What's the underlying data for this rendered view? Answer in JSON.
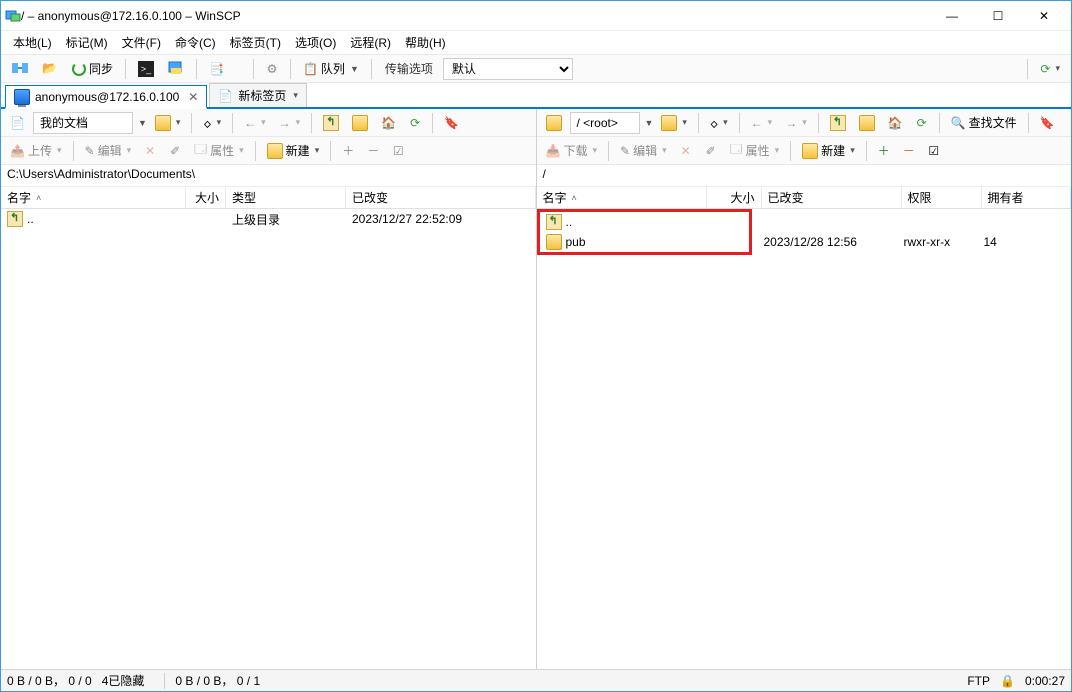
{
  "window": {
    "title": "/ – anonymous@172.16.0.100 – WinSCP"
  },
  "menu": {
    "items": [
      "本地(L)",
      "标记(M)",
      "文件(F)",
      "命令(C)",
      "标签页(T)",
      "选项(O)",
      "远程(R)",
      "帮助(H)"
    ]
  },
  "toolbar1": {
    "sync": "同步",
    "queue": "队列",
    "transfer_label": "传输选项",
    "transfer_value": "默认"
  },
  "tabs": {
    "active": "anonymous@172.16.0.100",
    "new": "新标签页"
  },
  "left": {
    "selector": "我的文档",
    "upload": "上传",
    "edit": "编辑",
    "props": "属性",
    "new": "新建",
    "path": "C:\\Users\\Administrator\\Documents\\",
    "cols": {
      "name": "名字",
      "size": "大小",
      "type": "类型",
      "changed": "已改变"
    },
    "rows": [
      {
        "name": "..",
        "type": "上级目录",
        "changed": "2023/12/27 22:52:09",
        "icon": "up"
      }
    ],
    "status": "0 B / 0 B， 0 / 0",
    "hidden": "4已隐藏"
  },
  "right": {
    "selector": "/ <root>",
    "download": "下载",
    "edit": "编辑",
    "props": "属性",
    "new": "新建",
    "find": "查找文件",
    "path": "/",
    "cols": {
      "name": "名字",
      "size": "大小",
      "changed": "已改变",
      "perms": "权限",
      "owner": "拥有者"
    },
    "rows": [
      {
        "name": "..",
        "icon": "up"
      },
      {
        "name": "pub",
        "icon": "folder",
        "changed": "2023/12/28 12:56",
        "perms": "rwxr-xr-x",
        "owner": "14"
      }
    ],
    "status": "0 B / 0 B， 0 / 1"
  },
  "statusbar": {
    "proto": "FTP",
    "time": "0:00:27"
  }
}
